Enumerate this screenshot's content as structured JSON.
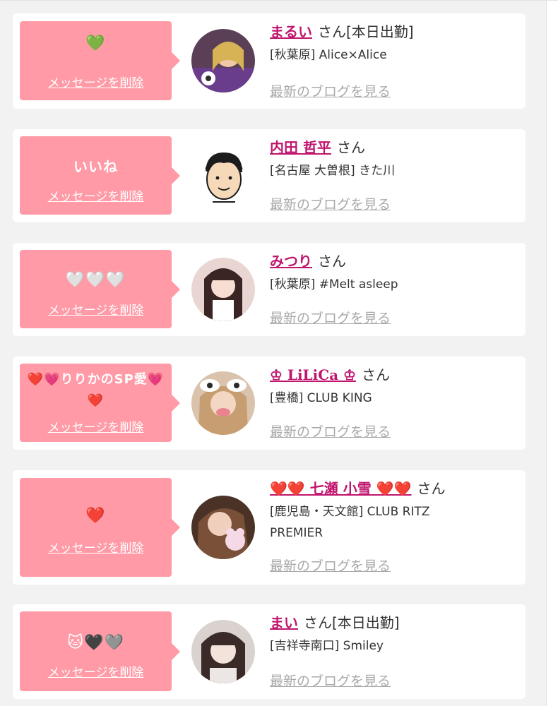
{
  "common": {
    "delete_label": "メッセージを削除",
    "san_label": "さん",
    "blog_label": "最新のブログを見る"
  },
  "colors": {
    "bubble": "#ff9aa6",
    "name_link": "#c0156e",
    "blog_link": "#a9a9a9"
  },
  "messages": [
    {
      "message": "💚",
      "name": "まるい",
      "suffix": "[本日出勤]",
      "shop": "[秋葉原] Alice×Alice",
      "avatar_icon": "avatar-photo"
    },
    {
      "message": "いいね",
      "name": "内田 哲平",
      "suffix": "",
      "shop": "[名古屋 大曽根] きた川",
      "avatar_icon": "avatar-illustration"
    },
    {
      "message": "🤍🤍🤍",
      "name": "みつり",
      "suffix": "",
      "shop": "[秋葉原] #Melt asleep",
      "avatar_icon": "avatar-photo"
    },
    {
      "message": "❤️💗りりかのSP愛💗❤️",
      "name": "♔ LiLiCa ♔",
      "suffix": "",
      "shop": "[豊橋] CLUB KING",
      "avatar_icon": "avatar-photo"
    },
    {
      "message": "❤️",
      "name": "❤️❤️ 七瀬 小雪 ❤️❤️",
      "suffix": "",
      "shop": "[鹿児島・天文館] CLUB RITZ PREMIER",
      "avatar_icon": "avatar-photo"
    },
    {
      "message": "🐱🖤🩶",
      "name": "まい",
      "suffix": "[本日出勤]",
      "shop": "[吉祥寺南口] Smiley",
      "avatar_icon": "avatar-photo"
    }
  ]
}
